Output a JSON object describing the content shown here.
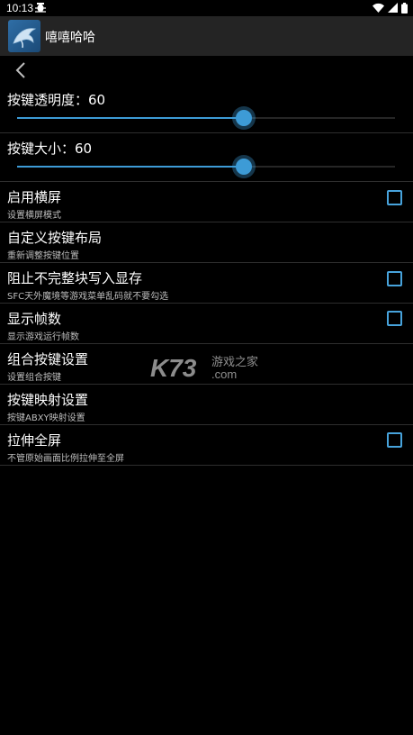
{
  "status_bar": {
    "time": "10:13"
  },
  "app_bar": {
    "title": "嘻嘻哈哈",
    "icon": "dolphin-app-icon"
  },
  "back_icon": "chevron-left-icon",
  "settings": {
    "opacity": {
      "label": "按键透明度：60",
      "value": 60,
      "max": 100
    },
    "size": {
      "label": "按键大小：60",
      "value": 60,
      "max": 100
    },
    "items": [
      {
        "title": "启用横屏",
        "summary": "设置横屏模式",
        "checkbox": true,
        "checked": false
      },
      {
        "title": "自定义按键布局",
        "summary": "重新调整按键位置",
        "checkbox": false
      },
      {
        "title": "阻止不完整块写入显存",
        "summary": "SFC天外魔境等游戏菜单乱码就不要勾选",
        "checkbox": true,
        "checked": false
      },
      {
        "title": "显示帧数",
        "summary": "显示游戏运行帧数",
        "checkbox": true,
        "checked": false
      },
      {
        "title": "组合按键设置",
        "summary": "设置组合按键",
        "checkbox": false
      },
      {
        "title": "按键映射设置",
        "summary": "按键ABXY映射设置",
        "checkbox": false
      },
      {
        "title": "拉伸全屏",
        "summary": "不管原始画面比例拉伸至全屏",
        "checkbox": true,
        "checked": false
      }
    ]
  },
  "watermark": {
    "brand": "K73",
    "text": "游戏之家",
    "domain": ".com"
  },
  "colors": {
    "accent": "#3d9bd6",
    "checkbox_border": "#47a3dc",
    "app_bar": "#242424",
    "background": "#000000"
  }
}
